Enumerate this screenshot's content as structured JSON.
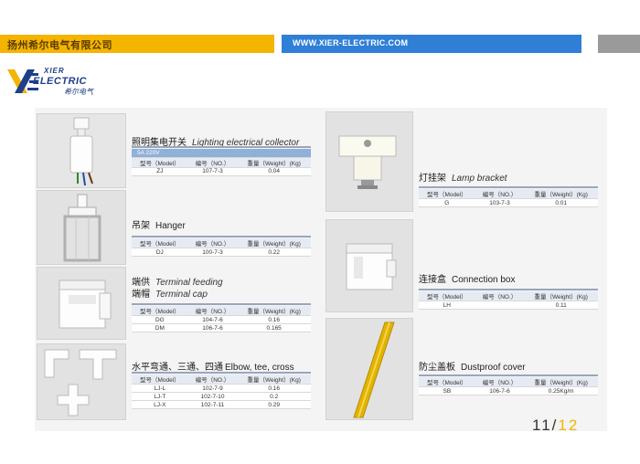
{
  "header": {
    "company": "扬州希尔电气有限公司",
    "website": "WWW.XIER-ELECTRIC.COM"
  },
  "logo": {
    "line1": "XIER",
    "line2": "ELECTRIC",
    "line3": "希尔电气"
  },
  "colors": {
    "accent_yellow": "#f4b400",
    "accent_blue": "#2f7fd6",
    "gray_block": "#9a9a9a"
  },
  "products": {
    "collector": {
      "cn": "照明集电开关",
      "en": "Lighting electrical collector",
      "rating": "5A   220V",
      "headers": [
        "型号（Model）",
        "编号（NO.）",
        "重量（Weight）(Kg)"
      ],
      "rows": [
        [
          "ZJ",
          "107-7-3",
          "0.04"
        ]
      ]
    },
    "hanger": {
      "cn": "吊架",
      "en": "Hanger",
      "headers": [
        "型号（Model）",
        "编号（NO.）",
        "重量（Weight）(Kg)"
      ],
      "rows": [
        [
          "DJ",
          "100-7-3",
          "0.22"
        ]
      ]
    },
    "terminal": {
      "cn1": "端供",
      "en1": "Terminal feeding",
      "cn2": "端帽",
      "en2": "Terminal cap",
      "headers": [
        "型号（Model）",
        "编号（NO.）",
        "重量（Weight）(Kg)"
      ],
      "rows": [
        [
          "DG",
          "104-7-6",
          "0.16"
        ],
        [
          "DM",
          "106-7-6",
          "0.165"
        ]
      ]
    },
    "elbow": {
      "cn": "水平弯通、三通、四通",
      "en": "Elbow, tee, cross",
      "headers": [
        "型号（Model）",
        "编号（NO.）",
        "重量（Weight）(Kg)"
      ],
      "rows": [
        [
          "LJ-L",
          "102-7-9",
          "0.16"
        ],
        [
          "LJ-T",
          "102-7-10",
          "0.2"
        ],
        [
          "LJ-X",
          "102-7-11",
          "0.29"
        ]
      ]
    },
    "lamp": {
      "cn": "灯挂架",
      "en": "Lamp bracket",
      "headers": [
        "型号（Model）",
        "编号（NO.）",
        "重量（Weight）(Kg)"
      ],
      "rows": [
        [
          "G",
          "103-7-3",
          "0.01"
        ]
      ]
    },
    "box": {
      "cn": "连接盒",
      "en": "Connection box",
      "headers": [
        "型号（Model）",
        "编号（NO.）",
        "重量（Weight）(Kg)"
      ],
      "rows": [
        [
          "LH",
          "",
          "0.11"
        ]
      ]
    },
    "cover": {
      "cn": "防尘盖板",
      "en": "Dustproof cover",
      "headers": [
        "型号（Model）",
        "编号（NO.）",
        "重量（Weight）(Kg)"
      ],
      "rows": [
        [
          "SB",
          "106-7-6",
          "0.25Kg/m"
        ]
      ]
    }
  },
  "page": {
    "current": "11",
    "separator": "/",
    "total": "12"
  }
}
